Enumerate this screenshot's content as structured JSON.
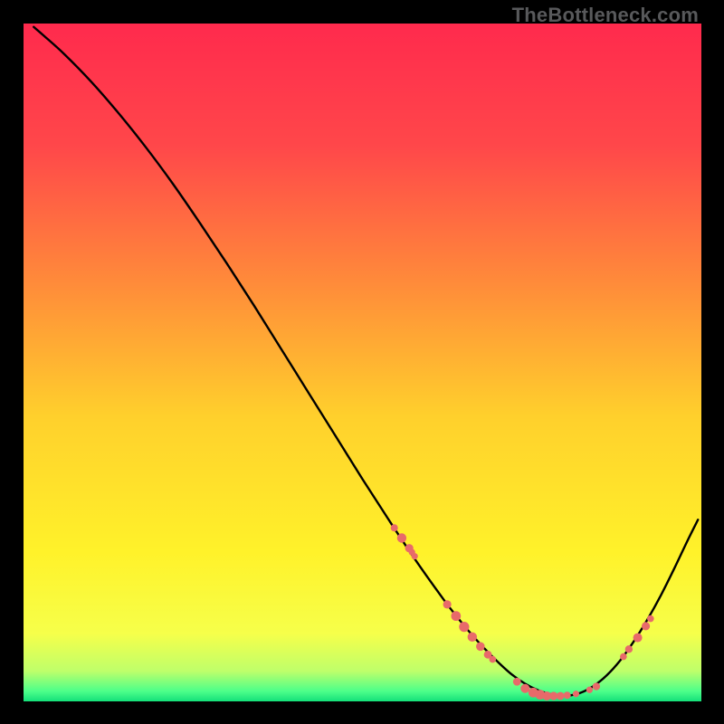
{
  "watermark": "TheBottleneck.com",
  "chart_data": {
    "type": "line",
    "title": "",
    "xlabel": "",
    "ylabel": "",
    "xlim": [
      0,
      100
    ],
    "ylim": [
      0,
      100
    ],
    "grid": false,
    "legend": false,
    "background_gradient": {
      "stops": [
        {
          "offset": 0.0,
          "color": "#ff2a4d"
        },
        {
          "offset": 0.18,
          "color": "#ff474a"
        },
        {
          "offset": 0.38,
          "color": "#ff8a3a"
        },
        {
          "offset": 0.58,
          "color": "#ffd02c"
        },
        {
          "offset": 0.78,
          "color": "#fff22a"
        },
        {
          "offset": 0.9,
          "color": "#f6ff4a"
        },
        {
          "offset": 0.955,
          "color": "#bfff6a"
        },
        {
          "offset": 0.985,
          "color": "#4dff8a"
        },
        {
          "offset": 1.0,
          "color": "#14e07a"
        }
      ]
    },
    "series": [
      {
        "name": "bottleneck-curve",
        "color": "#000000",
        "x": [
          1.5,
          3,
          6,
          10,
          14,
          18,
          22,
          26,
          30,
          34,
          38,
          42,
          46,
          50,
          54,
          58,
          62,
          64,
          66,
          68,
          70,
          72,
          74,
          76,
          78,
          80,
          82,
          84,
          86,
          88,
          90,
          92,
          94,
          96,
          98,
          99.5
        ],
        "y": [
          99.5,
          98.2,
          95.5,
          91.4,
          86.8,
          81.8,
          76.4,
          70.6,
          64.6,
          58.4,
          52.0,
          45.6,
          39.2,
          32.8,
          26.6,
          20.6,
          15.0,
          12.4,
          10.0,
          7.8,
          5.8,
          4.0,
          2.6,
          1.6,
          1.0,
          0.8,
          1.2,
          2.2,
          3.8,
          6.0,
          8.8,
          12.0,
          15.6,
          19.6,
          23.8,
          26.8
        ]
      }
    ],
    "marker_clusters": [
      {
        "name": "cluster-left",
        "type": "scatter",
        "color": "#e86a6a",
        "x": [
          54.7,
          55.8,
          56.9,
          57.3,
          57.7
        ],
        "y": [
          25.6,
          24.1,
          22.6,
          22.0,
          21.4
        ],
        "radius": [
          4.0,
          5.2,
          4.6,
          3.6,
          3.6
        ]
      },
      {
        "name": "cluster-mid-left",
        "type": "scatter",
        "color": "#e86a6a",
        "x": [
          62.5,
          63.8,
          65.0,
          66.2,
          67.4,
          68.5,
          69.2
        ],
        "y": [
          14.3,
          12.6,
          11.0,
          9.5,
          8.1,
          6.9,
          6.2
        ],
        "radius": [
          4.6,
          5.4,
          5.6,
          5.2,
          4.8,
          4.4,
          3.8
        ]
      },
      {
        "name": "cluster-bottom",
        "type": "scatter",
        "color": "#e86a6a",
        "x": [
          72.8,
          74.0,
          75.2,
          76.2,
          77.2,
          78.2,
          79.2,
          80.2,
          81.5,
          83.5,
          84.5
        ],
        "y": [
          2.9,
          1.9,
          1.3,
          1.0,
          0.8,
          0.8,
          0.8,
          0.9,
          1.1,
          1.7,
          2.2
        ],
        "radius": [
          4.4,
          5.0,
          5.4,
          5.4,
          5.0,
          4.6,
          4.4,
          4.0,
          3.6,
          3.6,
          4.2
        ]
      },
      {
        "name": "cluster-right",
        "type": "scatter",
        "color": "#e86a6a",
        "x": [
          88.5,
          89.3,
          90.6,
          91.8,
          92.5
        ],
        "y": [
          6.6,
          7.7,
          9.4,
          11.1,
          12.2
        ],
        "radius": [
          3.8,
          4.2,
          5.0,
          4.6,
          3.8
        ]
      }
    ]
  }
}
